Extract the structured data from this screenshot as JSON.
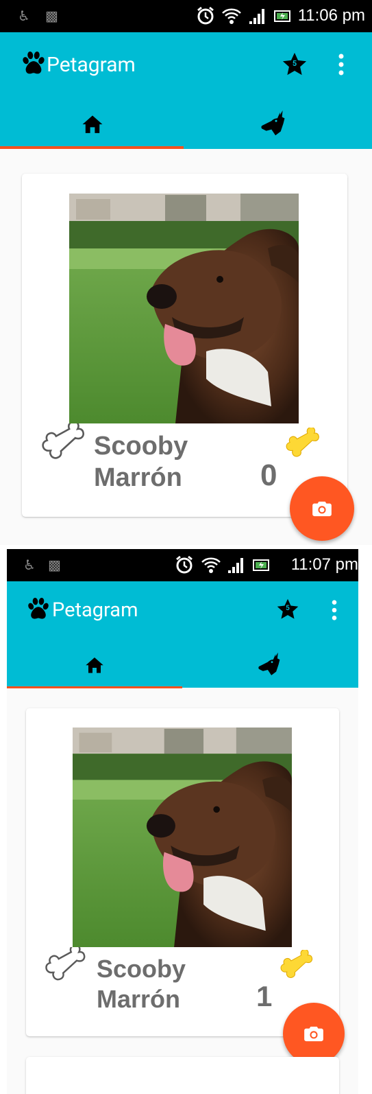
{
  "app": {
    "title": "Petagram",
    "favorites_badge": "5",
    "tabs": [
      {
        "icon": "home-icon"
      },
      {
        "icon": "dog-icon"
      }
    ]
  },
  "screens": [
    {
      "status_time": "11:06 pm",
      "pet": {
        "name_line1": "Scooby",
        "name_line2": "Marrón",
        "likes": "0"
      }
    },
    {
      "status_time": "11:07 pm",
      "pet": {
        "name_line1": "Scooby",
        "name_line2": "Marrón",
        "likes": "1"
      }
    }
  ],
  "colors": {
    "primary": "#00bcd4",
    "accent": "#ff5722",
    "indicator": "#f4511e",
    "status_bar": "#000000",
    "text_grey": "#6d6d6d",
    "bone_yellow": "#fdd835"
  },
  "icons": {
    "status_left": [
      "usb-icon",
      "android-icon"
    ],
    "status_right": [
      "alarm-icon",
      "wifi-icon",
      "signal-icon",
      "battery-icon"
    ],
    "toolbar": [
      "paw-icon",
      "star-icon",
      "overflow-menu-icon"
    ],
    "card": [
      "white-bone-icon",
      "yellow-bone-icon"
    ],
    "fab": "camera-icon"
  }
}
